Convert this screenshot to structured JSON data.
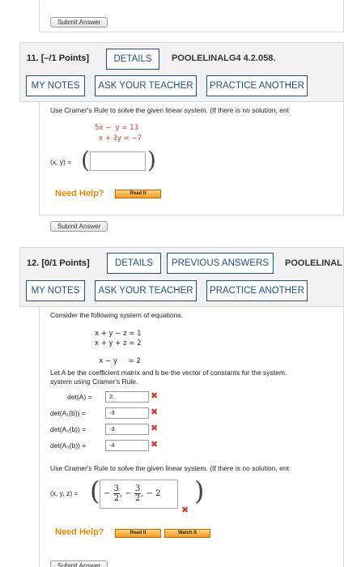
{
  "top": {
    "submit_label": "Submit Answer"
  },
  "q11": {
    "number": "11.",
    "points": "[–/1 Points]",
    "details_label": "DETAILS",
    "code": "POOLELINALG4 4.2.058.",
    "my_notes_label": "MY NOTES",
    "ask_teacher_label": "ASK YOUR TEACHER",
    "practice_label": "PRACTICE ANOTHER",
    "instruction": "Use Cramer's Rule to solve the given linear system. (If there is no solution, ent",
    "eq1": "5x −  y = 13",
    "eq2": "x + 3y = −7",
    "answer_label": "(x, y) =",
    "answer_value": "",
    "need_help": "Need Help?",
    "read_it": "Read It",
    "submit_label": "Submit Answer"
  },
  "q12": {
    "number": "12.",
    "points": "[0/1 Points]",
    "details_label": "DETAILS",
    "previous_label": "PREVIOUS ANSWERS",
    "code": "POOLELINAL",
    "my_notes_label": "MY NOTES",
    "ask_teacher_label": "ASK YOUR TEACHER",
    "practice_label": "PRACTICE ANOTHER",
    "consider": "Consider the following system of equations.",
    "eq1": "x + y − z = 1",
    "eq2": "x + y + z = 2",
    "eq3": "x − y     = 2",
    "let_text": "Let A be the coefficient matrix and b be the vector of constants for the system.",
    "let_text2": "system using Cramer's Rule.",
    "dets": [
      {
        "label": "det(A)  =",
        "value": "2"
      },
      {
        "label": "det(A₁(b))  =",
        "value": "-3"
      },
      {
        "label": "det(A₂(b))  =",
        "value": "-3"
      },
      {
        "label": "det(A₃(b))  =",
        "value": "-4"
      }
    ],
    "instruction": "Use Cramer's Rule to solve the given linear system. (If there is no solution, ent",
    "answer_label": "(x, y, z) =",
    "ans_num1": "3",
    "ans_den1": "2",
    "ans_num2": "3",
    "ans_den2": "2",
    "ans_last": "− 2",
    "need_help": "Need Help?",
    "read_it": "Read It",
    "watch_it": "Watch It",
    "submit_label": "Submit Answer"
  },
  "colors": {
    "accent": "#1f4f8c",
    "help": "#e08a00",
    "wrong": "#d43a2a"
  }
}
